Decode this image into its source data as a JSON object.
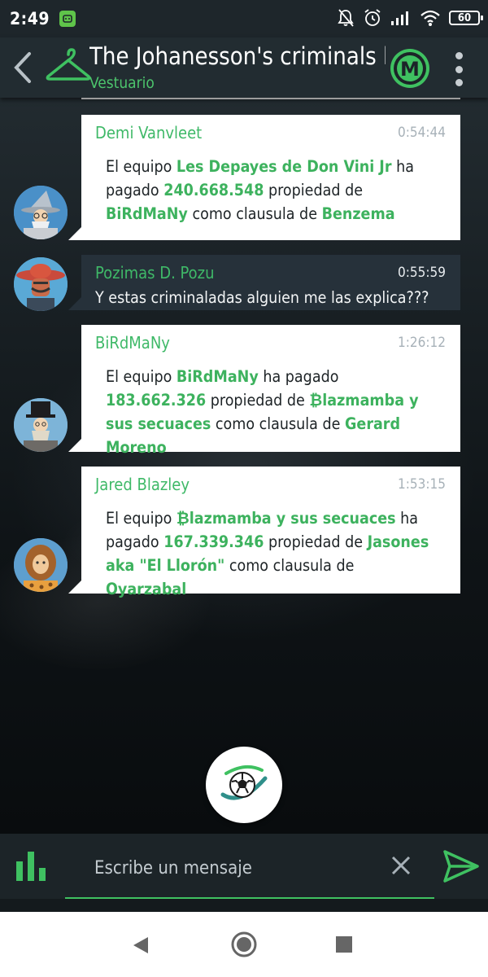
{
  "status_bar": {
    "time": "2:49",
    "battery": "60"
  },
  "header": {
    "title": "The Johanesson's criminals le",
    "subtitle": "Vestuario",
    "logo_letter": "M",
    "accent_color": "#4cc46c"
  },
  "messages": [
    {
      "sender": "Demi Vanvleet",
      "time": "0:54:44",
      "avatar": "wizard-avatar",
      "parts": [
        {
          "text": "El equipo ",
          "hl": false
        },
        {
          "text": "Les Depayes de Don Vini Jr",
          "hl": true
        },
        {
          "text": " ha pagado ",
          "hl": false
        },
        {
          "text": "240.668.548",
          "hl": true
        },
        {
          "text": " propiedad de ",
          "hl": false
        },
        {
          "text": "BiRdMaNy",
          "hl": true
        },
        {
          "text": " como clausula de ",
          "hl": false
        },
        {
          "text": "Benzema",
          "hl": true
        }
      ]
    },
    {
      "sender": "Pozimas D. Pozu",
      "time": "0:55:59",
      "avatar": "mexican-hat-avatar",
      "text": "Y estas criminaladas alguien me las explica???"
    },
    {
      "sender": "BiRdMaNy",
      "time": "1:26:12",
      "avatar": "top-hat-avatar",
      "parts": [
        {
          "text": "El equipo ",
          "hl": false
        },
        {
          "text": "BiRdMaNy",
          "hl": true
        },
        {
          "text": " ha pagado ",
          "hl": false
        },
        {
          "text": "183.662.326",
          "hl": true
        },
        {
          "text": " propiedad de ",
          "hl": false
        },
        {
          "text": "₿lazmamba y sus secuaces",
          "hl": true
        },
        {
          "text": " como clausula de ",
          "hl": false
        },
        {
          "text": "Gerard Moreno",
          "hl": true
        }
      ]
    },
    {
      "sender": "Jared Blazley",
      "time": "1:53:15",
      "avatar": "caveman-avatar",
      "parts": [
        {
          "text": "El equipo ",
          "hl": false
        },
        {
          "text": "₿lazmamba y sus secuaces",
          "hl": true
        },
        {
          "text": " ha pagado ",
          "hl": false
        },
        {
          "text": "167.339.346",
          "hl": true
        },
        {
          "text": " propiedad de ",
          "hl": false
        },
        {
          "text": "Jasones aka \"El Llorón\"",
          "hl": true
        },
        {
          "text": " como clausula de ",
          "hl": false
        },
        {
          "text": "Oyarzabal",
          "hl": true
        }
      ]
    }
  ],
  "input": {
    "placeholder": "Escribe un mensaje"
  },
  "icons": {
    "back": "back-arrow-icon",
    "hanger": "hanger-icon",
    "menu": "more-vert-icon",
    "stats": "bar-chart-icon",
    "clear": "close-icon",
    "send": "send-icon",
    "fab": "soccer-ball-icon"
  }
}
